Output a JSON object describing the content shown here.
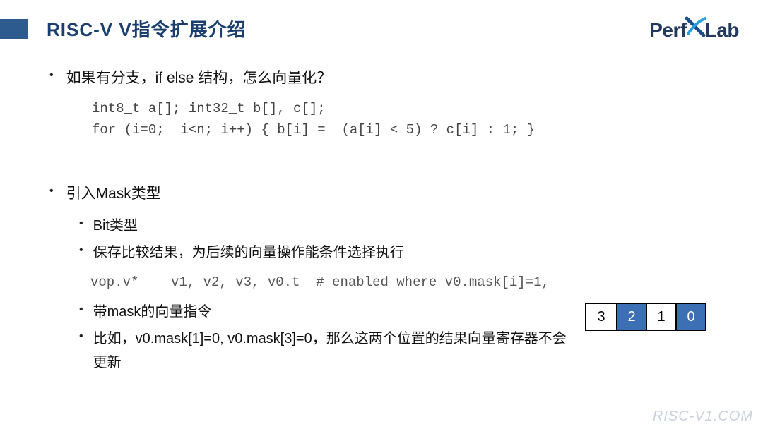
{
  "header": {
    "title": "RISC-V V指令扩展介绍",
    "logo": {
      "perf": "Perf",
      "lab": "Lab"
    }
  },
  "body": {
    "bullet1": "如果有分支，if else 结构，怎么向量化？",
    "code1_l1": "int8_t a[]; int32_t b[], c[];",
    "code1_l2": "for (i=0;  i<n; i++) { b[i] =  (a[i] < 5) ? c[i] : 1; }",
    "bullet2": "引入Mask类型",
    "sub2a": "Bit类型",
    "sub2b": "保存比较结果，为后续的向量操作能条件选择执行",
    "code2": "vop.v*    v1, v2, v3, v0.t  # enabled where v0.mask[i]=1,",
    "sub2c": "带mask的向量指令",
    "sub2d": "比如，v0.mask[1]=0, v0.mask[3]=0，那么这两个位置的结果向量寄存器不会更新",
    "bits": [
      "3",
      "2",
      "1",
      "0"
    ],
    "bitActive": [
      false,
      true,
      false,
      true
    ]
  },
  "watermark": "RISC-V1.COM"
}
